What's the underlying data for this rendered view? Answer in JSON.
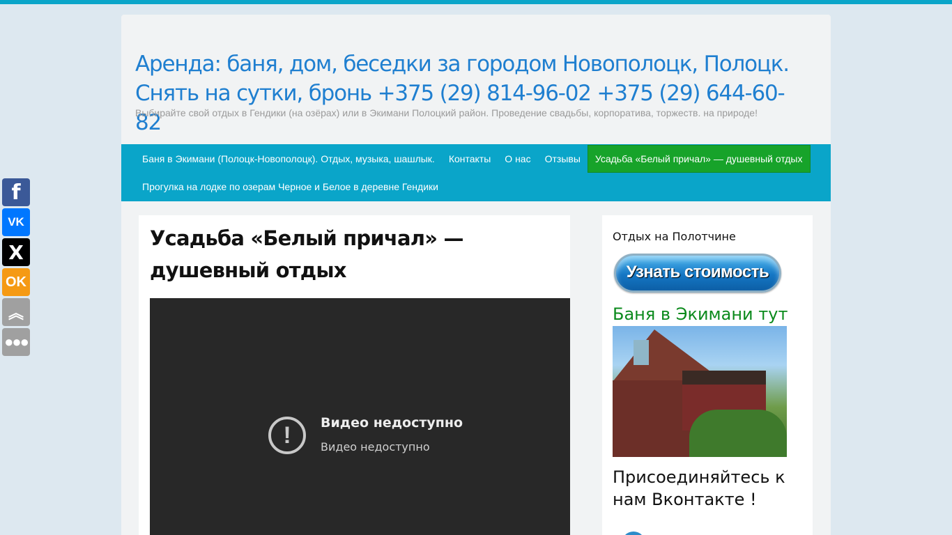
{
  "site": {
    "title": "Аренда: баня, дом, беседки за городом Новополоцк, Полоцк. Снять на сутки, бронь +375 (29) 814-96-02 +375 (29) 644-60-82",
    "description": "Выбирайте свой отдых в Гендики (на озёрах) или в Экимани Полоцкий район. Проведение свадьбы, корпоратива, торжеств. на природе!"
  },
  "nav": {
    "items": [
      {
        "label": "Баня в Экимани (Полоцк-Новополоцк). Отдых, музыка, шашлык."
      },
      {
        "label": "Контакты"
      },
      {
        "label": "О нас"
      },
      {
        "label": "Отзывы"
      },
      {
        "label": "Усадьба «Белый причал» — душевный отдых",
        "active": true
      },
      {
        "label": "Прогулка на лодке по озерам Черное и Белое в деревне Гендики"
      }
    ]
  },
  "post": {
    "title": "Усадьба «Белый причал» — душевный отдых",
    "video": {
      "error_title": "Видео недоступно",
      "error_subtitle": "Видео недоступно",
      "icon": "exclamation-circle-icon"
    }
  },
  "sidebar": {
    "heading1": "Отдых на Полотчине",
    "price_button": "Узнать стоимость",
    "heading2": "Баня в Экимани тут",
    "photo": "house-photo",
    "join_text": "Присоединяйтесь к нам Вконтакте !"
  },
  "share": {
    "buttons": [
      {
        "icon": "facebook-icon",
        "glyph": "f"
      },
      {
        "icon": "vk-icon",
        "glyph": "VK"
      },
      {
        "icon": "x-twitter-icon",
        "glyph": "X"
      },
      {
        "icon": "odnoklassniki-icon",
        "glyph": "OK"
      },
      {
        "icon": "scroll-up-icon",
        "glyph": "︽"
      },
      {
        "icon": "more-icon",
        "glyph": "●●●"
      }
    ]
  },
  "colors": {
    "accent": "#0aa5c9",
    "title": "#1f7fd0",
    "active_nav": "#17a32a",
    "sidebar_green": "#0b8a1c"
  }
}
